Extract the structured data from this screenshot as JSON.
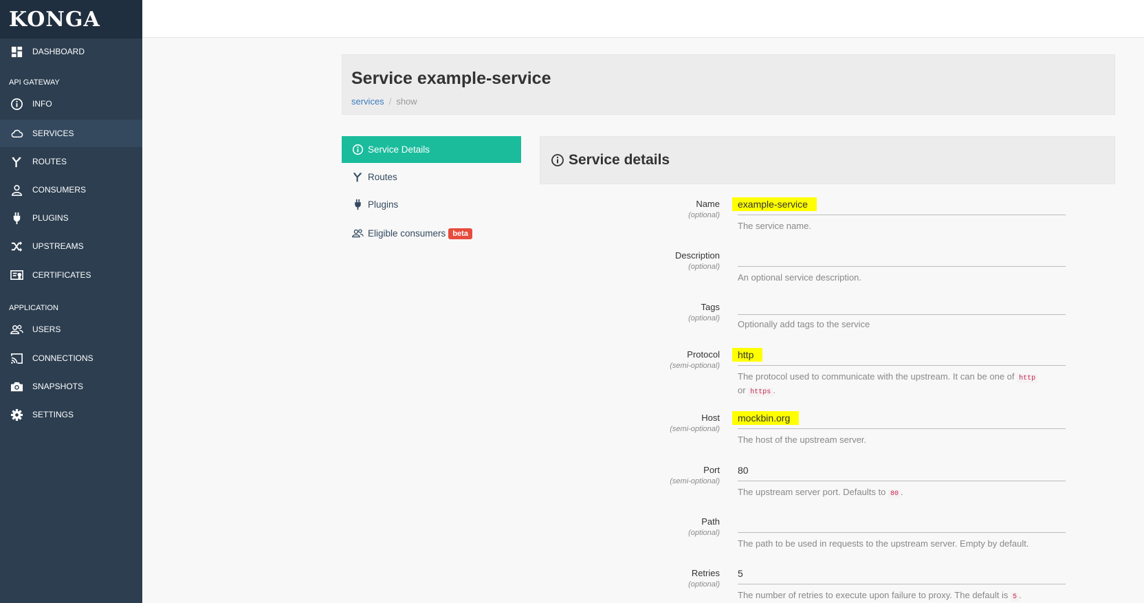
{
  "app": {
    "brand": "KONGA"
  },
  "sidebar": {
    "dashboard": "DASHBOARD",
    "sections": {
      "api_gateway": "API GATEWAY",
      "application": "APPLICATION"
    },
    "items": {
      "info": "INFO",
      "services": "SERVICES",
      "routes": "ROUTES",
      "consumers": "CONSUMERS",
      "plugins": "PLUGINS",
      "upstreams": "UPSTREAMS",
      "certificates": "CERTIFICATES",
      "users": "USERS",
      "connections": "CONNECTIONS",
      "snapshots": "SNAPSHOTS",
      "settings": "SETTINGS"
    },
    "active": "services"
  },
  "header": {
    "title": "Service example-service",
    "breadcrumb": {
      "link": "services",
      "separator": "/",
      "current": "show"
    }
  },
  "tabs": {
    "service_details": "Service Details",
    "routes": "Routes",
    "plugins": "Plugins",
    "eligible_consumers": "Eligible consumers",
    "beta_badge": "beta"
  },
  "details": {
    "heading": "Service details",
    "fields": {
      "name": {
        "label": "Name",
        "hint": "(optional)",
        "value": "example-service",
        "help": "The service name."
      },
      "description": {
        "label": "Description",
        "hint": "(optional)",
        "value": "",
        "help": "An optional service description."
      },
      "tags": {
        "label": "Tags",
        "hint": "(optional)",
        "value": "",
        "help": "Optionally add tags to the service"
      },
      "protocol": {
        "label": "Protocol",
        "hint": "(semi-optional)",
        "value": "http",
        "help_pre": "The protocol used to communicate with the upstream. It can be one of",
        "help_code1": "http",
        "help_mid": "or",
        "help_code2": "https",
        "help_post": "."
      },
      "host": {
        "label": "Host",
        "hint": "(semi-optional)",
        "value": "mockbin.org",
        "help": "The host of the upstream server."
      },
      "port": {
        "label": "Port",
        "hint": "(semi-optional)",
        "value": "80",
        "help_pre": "The upstream server port. Defaults to",
        "help_code": "80",
        "help_post": "."
      },
      "path": {
        "label": "Path",
        "hint": "(optional)",
        "value": "",
        "help": "The path to be used in requests to the upstream server. Empty by default."
      },
      "retries": {
        "label": "Retries",
        "hint": "(optional)",
        "value": "5",
        "help_pre": "The number of retries to execute upon failure to proxy. The default is",
        "help_code": "5",
        "help_post": "."
      }
    }
  },
  "colors": {
    "sidebar_bg": "#2c3e50",
    "active_tab": "#1abc9c",
    "highlight": "#ffff00",
    "badge": "#e74c3c"
  }
}
